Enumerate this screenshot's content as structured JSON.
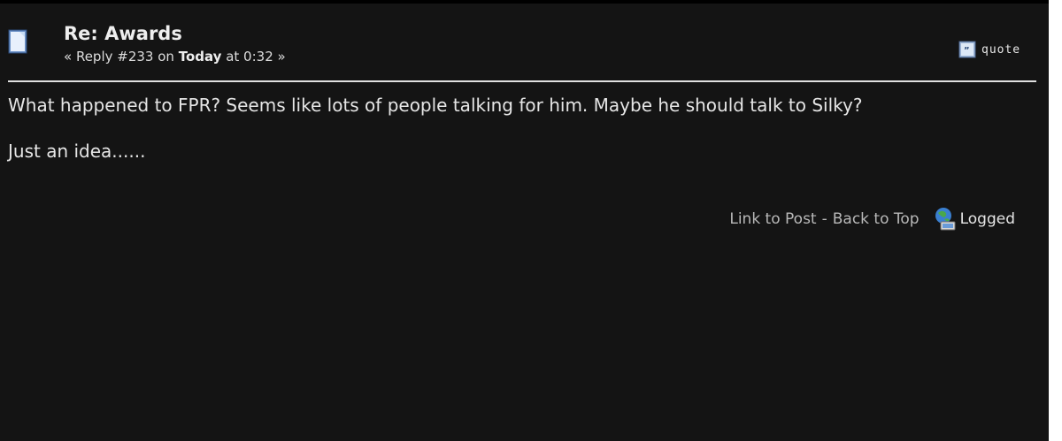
{
  "post": {
    "subject": "Re: Awards",
    "meta": {
      "prefix": "« Reply #233 on",
      "day": "Today",
      "suffix": "at 0:32 »"
    },
    "quote_label": "quote",
    "body": [
      "What happened to FPR? Seems like lots of people talking for him. Maybe he should talk to Silky?",
      "Just an idea......"
    ],
    "footer": {
      "link_to_post": "Link to Post",
      "separator": "-",
      "back_to_top": "Back to Top",
      "logged": "Logged"
    }
  },
  "icons": {
    "post": "document-icon",
    "quote": "quote-icon",
    "logged": "globe-computer-icon"
  }
}
